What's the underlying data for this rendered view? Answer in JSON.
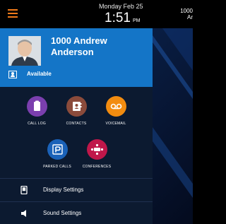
{
  "status_bar": {
    "date": "Monday Feb 25",
    "time": "1:51",
    "ampm": "PM",
    "line_ext": "1000",
    "line_name": "Ar"
  },
  "user": {
    "name": "1000 Andrew Anderson",
    "presence": "Available"
  },
  "apps": [
    {
      "label": "CALL LOG",
      "icon": "clipboard-icon",
      "color": "#7b3fae"
    },
    {
      "label": "CONTACTS",
      "icon": "contacts-book-icon",
      "color": "#8b4b3b"
    },
    {
      "label": "VOICEMAIL",
      "icon": "voicemail-icon",
      "color": "#f28c10"
    },
    {
      "label": "PARKED CALLS",
      "icon": "parking-icon",
      "color": "#1b62b8"
    },
    {
      "label": "CONFERENCES",
      "icon": "conference-icon",
      "color": "#c0174a"
    }
  ],
  "settings": [
    {
      "label": "Display Settings",
      "icon": "phone-display-icon"
    },
    {
      "label": "Sound Settings",
      "icon": "speaker-icon"
    }
  ],
  "colors": {
    "accent": "#f07a1a",
    "user_card": "#1475c7",
    "drawer": "#0c1a30",
    "background": "#06102a"
  }
}
